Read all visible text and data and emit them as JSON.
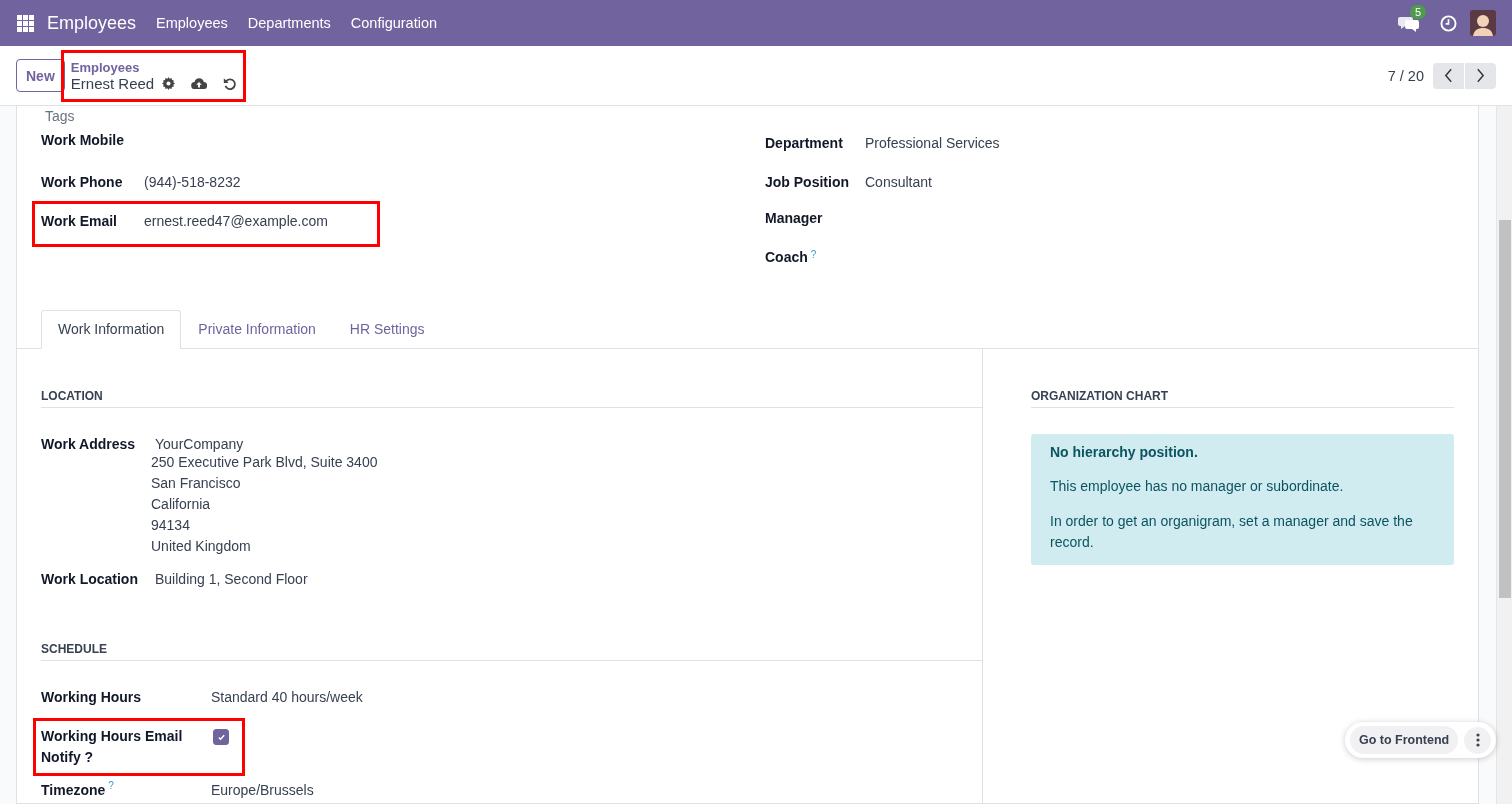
{
  "navbar": {
    "app_title": "Employees",
    "menu": [
      {
        "label": "Employees"
      },
      {
        "label": "Departments"
      },
      {
        "label": "Configuration"
      }
    ],
    "messages_badge": "5"
  },
  "control_panel": {
    "new_button": "New",
    "breadcrumb": {
      "parent": "Employees",
      "current": "Ernest Reed",
      "highlighted": true
    },
    "pager": "7 / 20"
  },
  "tags_placeholder": "Tags",
  "left_fields": [
    {
      "label": "Work Mobile",
      "highlighted": false
    },
    {
      "label": "Work Phone",
      "value": "(944)-518-8232",
      "highlighted": false
    },
    {
      "label": "Work Email",
      "value": "ernest.reed47@example.com",
      "highlighted": true
    }
  ],
  "right_fields": [
    {
      "label": "Department",
      "value": "Professional Services"
    },
    {
      "label": "Job Position",
      "value": "Consultant"
    },
    {
      "label": "Manager"
    },
    {
      "label": "Coach",
      "help": "?"
    }
  ],
  "tabs": [
    {
      "label": "Work Information",
      "selected": true
    },
    {
      "label": "Private Information",
      "selected": false
    },
    {
      "label": "HR Settings",
      "selected": false
    }
  ],
  "location": {
    "title": "LOCATION",
    "address": {
      "label": "Work Address",
      "company": "YourCompany",
      "lines": [
        "250 Executive Park Blvd, Suite 3400",
        "San Francisco",
        "California",
        "94134",
        "United Kingdom"
      ]
    },
    "work_location": {
      "label": "Work Location",
      "value": "Building 1, Second Floor"
    }
  },
  "schedule": {
    "title": "SCHEDULE",
    "fields": [
      {
        "kind": "text",
        "label": "Working Hours",
        "value": "Standard 40 hours/week",
        "highlighted": false
      },
      {
        "kind": "checkbox",
        "label": "Working Hours Email Notify ?",
        "checked": true,
        "highlighted": true
      },
      {
        "kind": "text",
        "label": "Timezone",
        "help": "?",
        "value": "Europe/Brussels",
        "highlighted": false
      }
    ]
  },
  "org_chart": {
    "title": "ORGANIZATION CHART",
    "alert_title": "No hierarchy position.",
    "paragraphs": [
      "This employee has no manager or subordinate.",
      "In order to get an organigram, set a manager and save the record."
    ]
  },
  "floating": {
    "button": "Go to Frontend"
  }
}
